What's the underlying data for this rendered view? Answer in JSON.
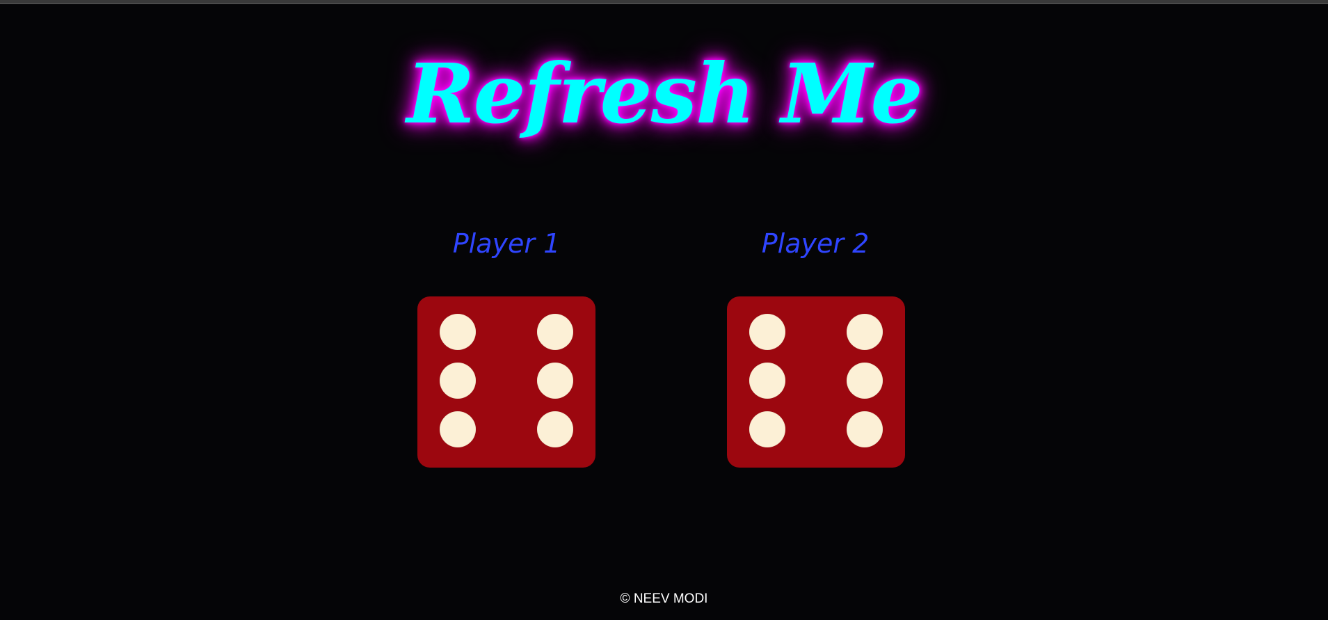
{
  "title": "Refresh Me",
  "players": [
    {
      "label": "Player 1",
      "die_value": 6
    },
    {
      "label": "Player 2",
      "die_value": 6
    }
  ],
  "footer": "© NEEV MODI",
  "colors": {
    "background": "#050507",
    "title_text": "#00ffff",
    "title_glow": "#ff00ff",
    "player_label": "#2f45ff",
    "die_face": "#9c070f",
    "pip": "#fcf0d6",
    "footer_text": "#ffffff"
  }
}
